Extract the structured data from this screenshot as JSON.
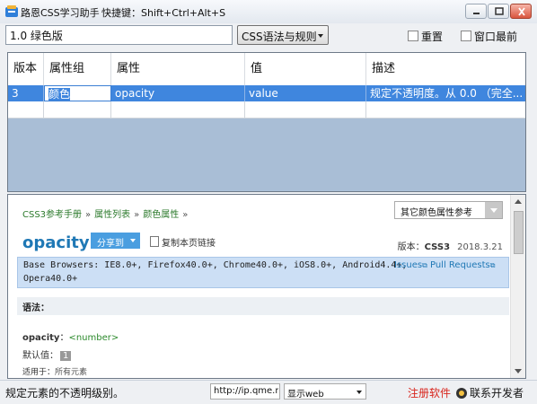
{
  "window": {
    "title": "路恩CSS学习助手",
    "hotkey": "快捷键：Shift+Ctrl+Alt+S"
  },
  "toolbar": {
    "version_value": "1.0 绿色版",
    "mode_select": "CSS语法与规则",
    "reset_label": "重置",
    "topmost_label": "窗口最前"
  },
  "grid": {
    "columns": [
      "版本",
      "属性组",
      "属性",
      "值",
      "描述"
    ],
    "rows": [
      {
        "version": "3",
        "group": "颜色",
        "property": "opacity",
        "value": "value",
        "description": "规定不透明度。从 0.0 （完全..."
      }
    ]
  },
  "doc": {
    "breadcrumb": [
      "CSS3参考手册",
      "属性列表",
      "颜色属性"
    ],
    "breadcrumb_sep": "»",
    "ref_select": "其它颜色属性参考",
    "property_name": "opacity",
    "share_label": "分享到",
    "copy_link_label": "复制本页链接",
    "version_label": "版本：",
    "version_value": "CSS3",
    "date": "2018.3.21",
    "browsers_line1": "Base Browsers: IE8.0+, Firefox40.0+, Chrome40.0+, iOS8.0+, Android4.4+,",
    "browsers_line2": "Opera40.0+",
    "issues_label": "Issues",
    "pull_requests_label": "Pull Requests",
    "syntax_heading": "语法：",
    "syntax_prop": "opacity",
    "syntax_colon": "：",
    "syntax_value": "<number>",
    "default_label": "默认值：",
    "default_value": "1",
    "applies_label": "适用于：",
    "applies_value": "所有元素"
  },
  "status": {
    "text": "规定元素的不透明级别。",
    "url": "http://ip.qme.na",
    "mode": "显示web",
    "register": "注册软件",
    "contact": "联系开发者"
  },
  "colors": {
    "selection": "#3f86de",
    "link_green": "#2c7a2c",
    "title_blue": "#1f78b5",
    "register_red": "#d8241c"
  }
}
